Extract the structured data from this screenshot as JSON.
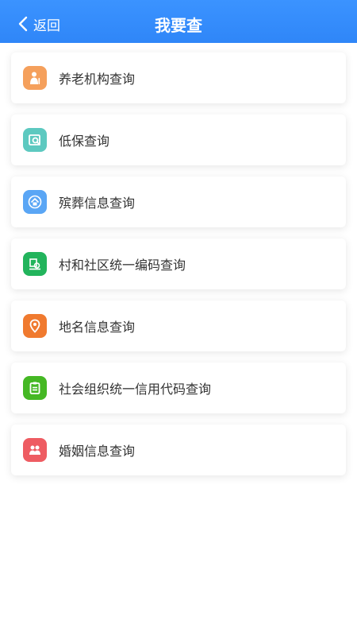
{
  "header": {
    "back_label": "返回",
    "title": "我要查",
    "color": "#3490fb"
  },
  "items": [
    {
      "label": "养老机构查询",
      "icon": "elderly-person-icon",
      "color": "#f5a05c"
    },
    {
      "label": "低保查询",
      "icon": "search-document-icon",
      "color": "#5dc9c0"
    },
    {
      "label": "殡葬信息查询",
      "icon": "funeral-house-icon",
      "color": "#5aa6f5"
    },
    {
      "label": "村和社区统一编码查询",
      "icon": "community-building-icon",
      "color": "#22b45c"
    },
    {
      "label": "地名信息查询",
      "icon": "location-pin-icon",
      "color": "#f07a2f"
    },
    {
      "label": "社会组织统一信用代码查询",
      "icon": "clipboard-icon",
      "color": "#45b824"
    },
    {
      "label": "婚姻信息查询",
      "icon": "couple-icon",
      "color": "#ee5c62"
    }
  ]
}
